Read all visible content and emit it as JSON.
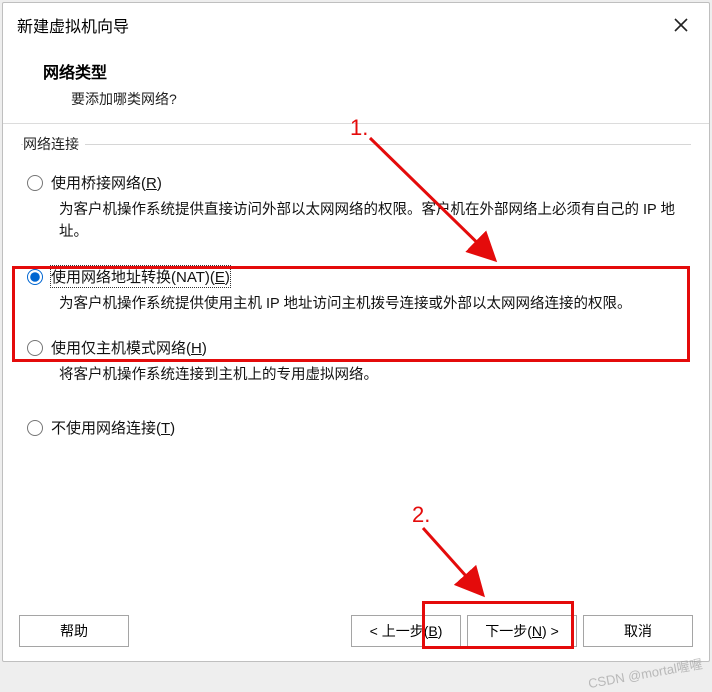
{
  "title": "新建虚拟机向导",
  "header": {
    "h1": "网络类型",
    "h2": "要添加哪类网络?"
  },
  "group_legend": "网络连接",
  "annotations": {
    "one": "1.",
    "two": "2."
  },
  "options": {
    "bridged": {
      "label_prefix": "使用桥接网络(",
      "mnemonic": "R",
      "label_suffix": ")",
      "desc": "为客户机操作系统提供直接访问外部以太网网络的权限。客户机在外部网络上必须有自己的 IP 地址。"
    },
    "nat": {
      "label_prefix": "使用网络地址转换(NAT)(",
      "mnemonic": "E",
      "label_suffix": ")",
      "desc": "为客户机操作系统提供使用主机 IP 地址访问主机拨号连接或外部以太网网络连接的权限。"
    },
    "hostonly": {
      "label_prefix": "使用仅主机模式网络(",
      "mnemonic": "H",
      "label_suffix": ")",
      "desc": "将客户机操作系统连接到主机上的专用虚拟网络。"
    },
    "none": {
      "label_prefix": "不使用网络连接(",
      "mnemonic": "T",
      "label_suffix": ")"
    }
  },
  "buttons": {
    "help": "帮助",
    "back_prefix": "< 上一步(",
    "back_m": "B",
    "back_suffix": ")",
    "next_prefix": "下一步(",
    "next_m": "N",
    "next_suffix": ") >",
    "cancel": "取消"
  },
  "watermark": "CSDN @mortal喔喔"
}
